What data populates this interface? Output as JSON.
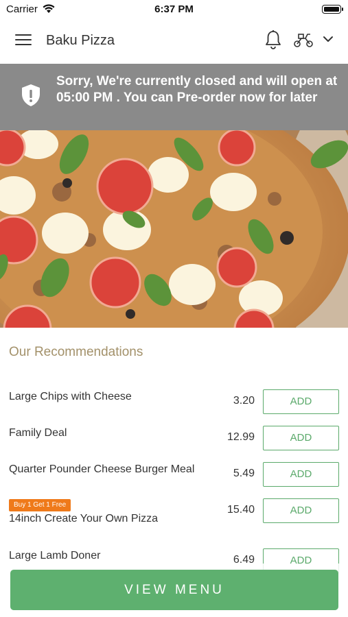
{
  "status_bar": {
    "carrier": "Carrier",
    "time": "6:37 PM"
  },
  "header": {
    "title": "Baku Pizza",
    "icons": [
      "menu-icon",
      "bell-icon",
      "scooter-icon",
      "chevron-down-icon"
    ]
  },
  "banner": {
    "message": "Sorry, We're currently closed and will open at 05:00 PM . You can Pre-order now for later",
    "icon": "shield-alert-icon"
  },
  "recommendations": {
    "title": "Our Recommendations",
    "items": [
      {
        "name": "Large Chips with Cheese",
        "price": "3.20",
        "button": "ADD",
        "badge": ""
      },
      {
        "name": "Family Deal",
        "price": "12.99",
        "button": "ADD",
        "badge": ""
      },
      {
        "name": "Quarter Pounder Cheese Burger Meal",
        "price": "5.49",
        "button": "ADD",
        "badge": ""
      },
      {
        "name": "14inch Create Your Own Pizza",
        "price": "15.40",
        "button": "ADD",
        "badge": "Buy 1 Get 1 Free"
      },
      {
        "name": "Large Lamb Doner",
        "price": "6.49",
        "button": "ADD",
        "badge": ""
      }
    ]
  },
  "cta": {
    "label": "VIEW MENU"
  },
  "colors": {
    "accent_green": "#5eb06f",
    "banner_gray": "#8a8a8a",
    "section_title": "#a3916a",
    "badge_orange": "#ef7a1a"
  }
}
